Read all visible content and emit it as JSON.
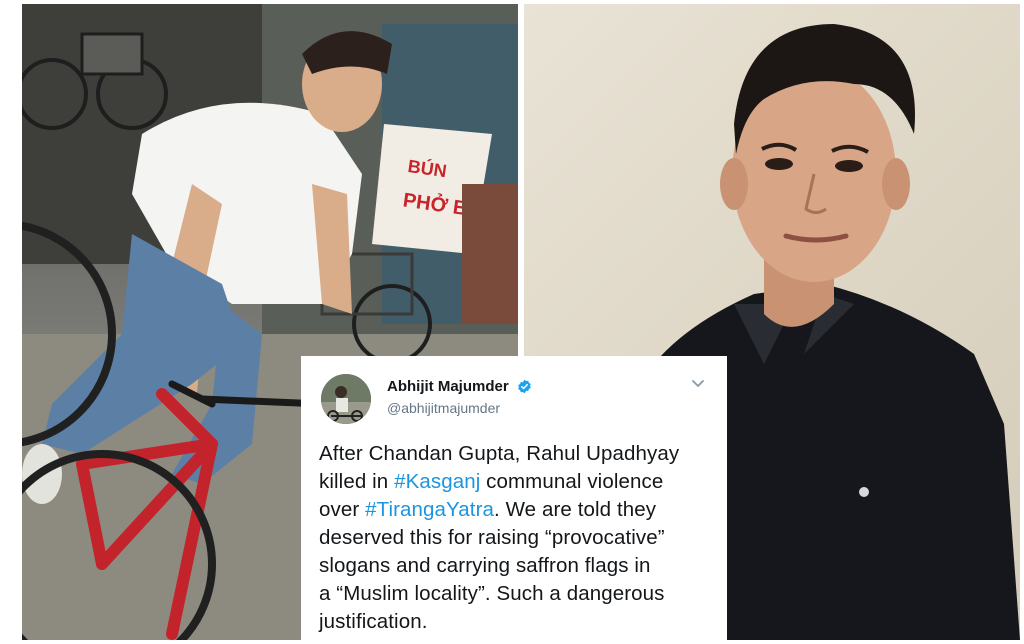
{
  "tweet": {
    "display_name": "Abhijit Majumder",
    "handle": "@abhijitmajumder",
    "avatar_icon": "avatar-photo",
    "verified_icon": "verified-badge-icon",
    "menu_icon": "chevron-down-icon",
    "lines": [
      [
        "After Chandan Gupta, Rahul Upadhyay"
      ],
      [
        "killed in ",
        "#Kasganj",
        " communal violence"
      ],
      [
        "over ",
        "#TirangaYatra",
        ". We are told they"
      ],
      [
        "deserved this for raising “provocative”"
      ],
      [
        "slogans and carrying saffron flags in"
      ],
      [
        "a “Muslim locality”. Such a dangerous"
      ],
      [
        "justification."
      ]
    ],
    "hashtag_color": "#1b95e0",
    "text_color": "#14171a",
    "handle_color": "#657786"
  },
  "photos": {
    "left": "man-on-red-bicycle-photo",
    "right": "young-man-portrait-photo"
  }
}
